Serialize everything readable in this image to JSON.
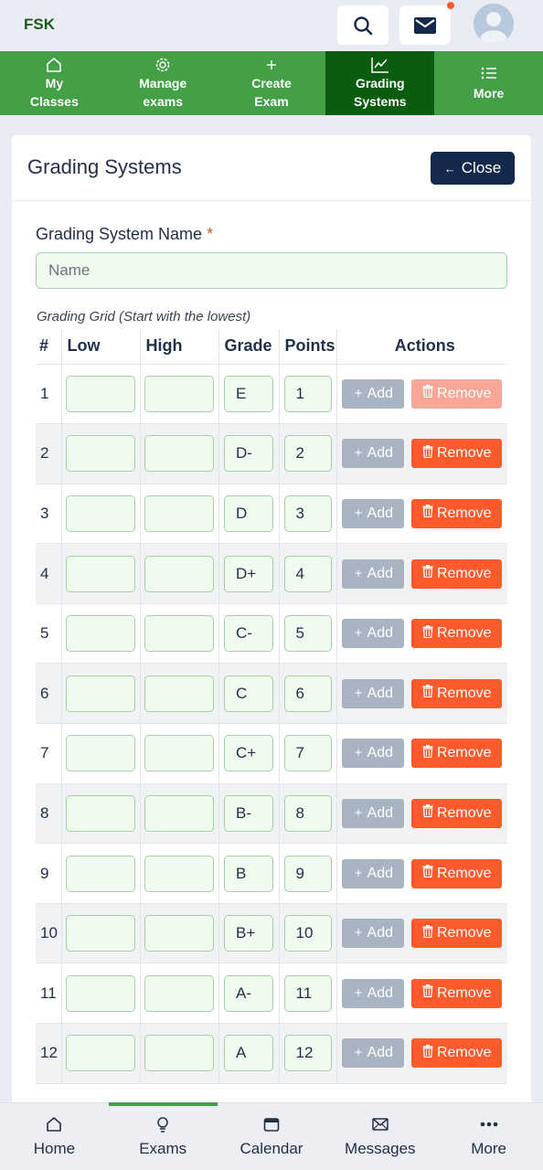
{
  "app": {
    "brand": "FSK",
    "has_notification": true,
    "accent_color": "#43a047",
    "active_nav_color": "#0a5c0e"
  },
  "top_nav": [
    {
      "label": "My\nClasses",
      "icon": "home-icon",
      "active": false
    },
    {
      "label": "Manage\nexams",
      "icon": "gear-icon",
      "active": false
    },
    {
      "label": "Create\nExam",
      "icon": "plus-icon",
      "active": false
    },
    {
      "label": "Grading\nSystems",
      "icon": "chart-icon",
      "active": true
    },
    {
      "label": "More",
      "icon": "list-icon",
      "active": false
    }
  ],
  "page": {
    "title": "Grading Systems",
    "close_label": "Close",
    "name_label": "Grading System Name",
    "required_mark": "*",
    "name_placeholder": "Name",
    "name_value": "",
    "grid_caption": "Grading Grid (Start with the lowest)"
  },
  "grid": {
    "headers": {
      "num": "#",
      "low": "Low",
      "high": "High",
      "grade": "Grade",
      "points": "Points",
      "actions": "Actions"
    },
    "add_label": "Add",
    "remove_label": "Remove",
    "rows": [
      {
        "n": "1",
        "low": "",
        "high": "",
        "grade": "E",
        "points": "1",
        "remove_disabled": true
      },
      {
        "n": "2",
        "low": "",
        "high": "",
        "grade": "D-",
        "points": "2",
        "remove_disabled": false
      },
      {
        "n": "3",
        "low": "",
        "high": "",
        "grade": "D",
        "points": "3",
        "remove_disabled": false
      },
      {
        "n": "4",
        "low": "",
        "high": "",
        "grade": "D+",
        "points": "4",
        "remove_disabled": false
      },
      {
        "n": "5",
        "low": "",
        "high": "",
        "grade": "C-",
        "points": "5",
        "remove_disabled": false
      },
      {
        "n": "6",
        "low": "",
        "high": "",
        "grade": "C",
        "points": "6",
        "remove_disabled": false
      },
      {
        "n": "7",
        "low": "",
        "high": "",
        "grade": "C+",
        "points": "7",
        "remove_disabled": false
      },
      {
        "n": "8",
        "low": "",
        "high": "",
        "grade": "B-",
        "points": "8",
        "remove_disabled": false
      },
      {
        "n": "9",
        "low": "",
        "high": "",
        "grade": "B",
        "points": "9",
        "remove_disabled": false
      },
      {
        "n": "10",
        "low": "",
        "high": "",
        "grade": "B+",
        "points": "10",
        "remove_disabled": false
      },
      {
        "n": "11",
        "low": "",
        "high": "",
        "grade": "A-",
        "points": "11",
        "remove_disabled": false
      },
      {
        "n": "12",
        "low": "",
        "high": "",
        "grade": "A",
        "points": "12",
        "remove_disabled": false
      }
    ]
  },
  "bottom_nav": [
    {
      "label": "Home",
      "icon": "home-icon",
      "active": false
    },
    {
      "label": "Exams",
      "icon": "lightbulb-icon",
      "active": true
    },
    {
      "label": "Calendar",
      "icon": "calendar-icon",
      "active": false
    },
    {
      "label": "Messages",
      "icon": "envelope-icon",
      "active": false
    },
    {
      "label": "More",
      "icon": "dots-icon",
      "active": false
    }
  ]
}
